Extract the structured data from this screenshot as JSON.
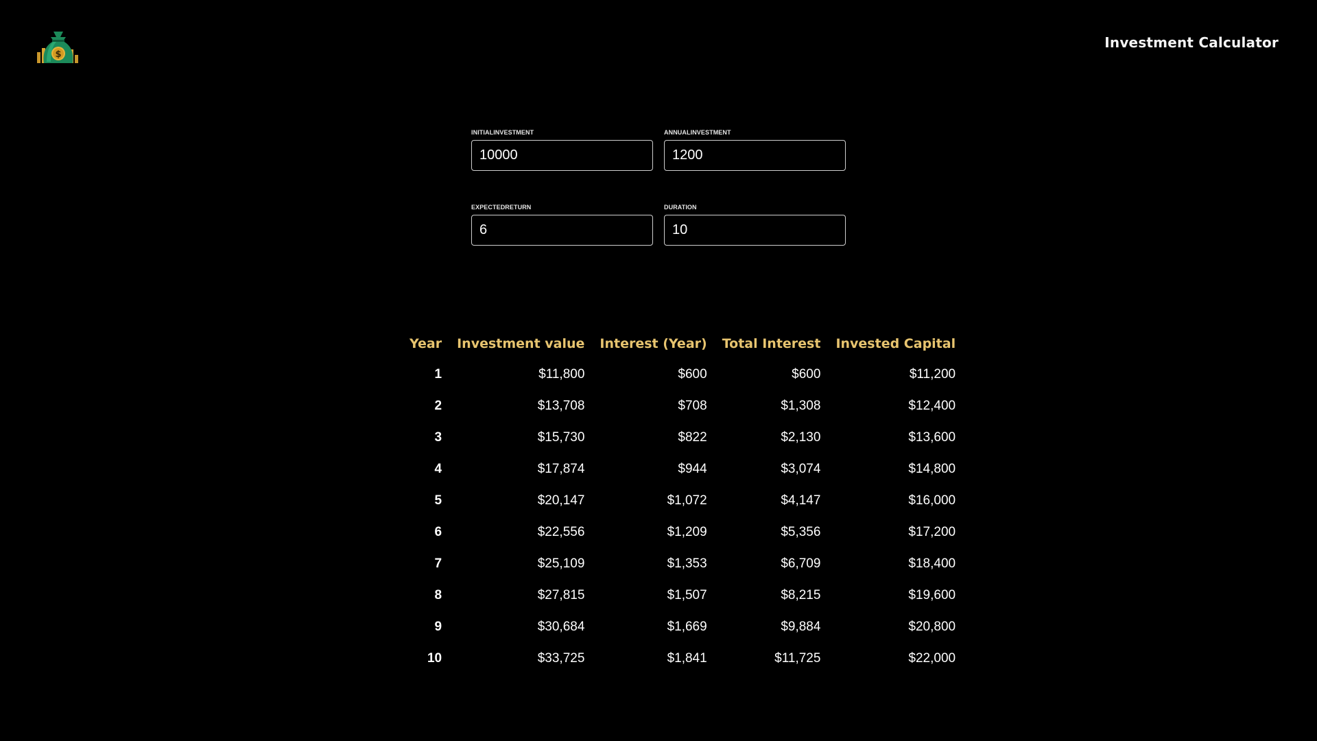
{
  "header": {
    "title": "Investment Calculator",
    "logo_icon": "money-bag-logo-icon"
  },
  "inputs": [
    {
      "label": "INITIALINVESTMENT",
      "value": "10000"
    },
    {
      "label": "ANNUALINVESTMENT",
      "value": "1200"
    },
    {
      "label": "EXPECTEDRETURN",
      "value": "6"
    },
    {
      "label": "DURATION",
      "value": "10"
    }
  ],
  "table": {
    "columns": [
      "Year",
      "Investment value",
      "Interest (Year)",
      "Total Interest",
      "Invested Capital"
    ],
    "rows": [
      [
        "1",
        "$11,800",
        "$600",
        "$600",
        "$11,200"
      ],
      [
        "2",
        "$13,708",
        "$708",
        "$1,308",
        "$12,400"
      ],
      [
        "3",
        "$15,730",
        "$822",
        "$2,130",
        "$13,600"
      ],
      [
        "4",
        "$17,874",
        "$944",
        "$3,074",
        "$14,800"
      ],
      [
        "5",
        "$20,147",
        "$1,072",
        "$4,147",
        "$16,000"
      ],
      [
        "6",
        "$22,556",
        "$1,209",
        "$5,356",
        "$17,200"
      ],
      [
        "7",
        "$25,109",
        "$1,353",
        "$6,709",
        "$18,400"
      ],
      [
        "8",
        "$27,815",
        "$1,507",
        "$8,215",
        "$19,600"
      ],
      [
        "9",
        "$30,684",
        "$1,669",
        "$9,884",
        "$20,800"
      ],
      [
        "10",
        "$33,725",
        "$1,841",
        "$11,725",
        "$22,000"
      ]
    ]
  },
  "colors": {
    "background": "#000000",
    "header_accent": "#e7c46f",
    "text": "#ffffff"
  }
}
